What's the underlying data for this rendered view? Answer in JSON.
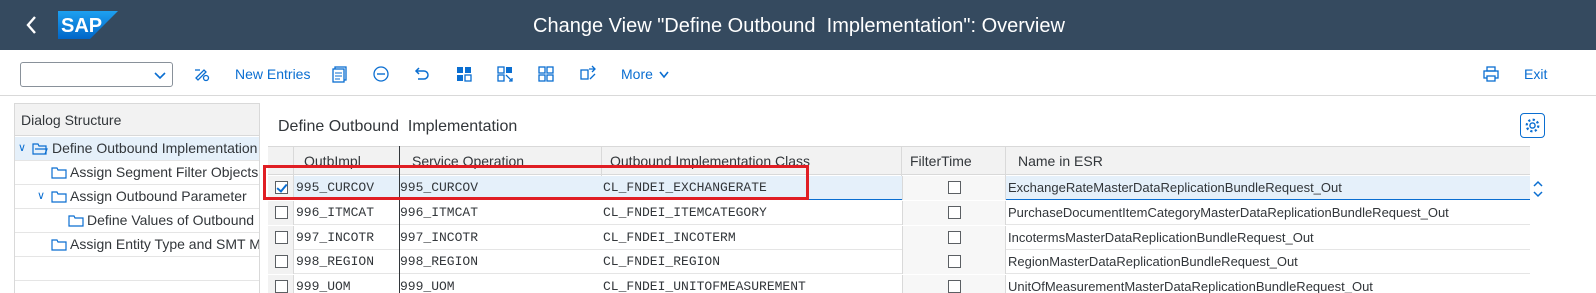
{
  "header": {
    "title": "Change View \"Define Outbound  Implementation\": Overview",
    "logo_text": "SAP"
  },
  "toolbar": {
    "dropdown_value": "",
    "new_entries": "New Entries",
    "more": "More",
    "exit": "Exit"
  },
  "dialog": {
    "heading": "Dialog Structure",
    "items": [
      {
        "label": "Define Outbound  Implementation",
        "selected": true
      },
      {
        "label": "Assign Segment Filter Objects"
      },
      {
        "label": "Assign Outbound Parameter"
      },
      {
        "label": "Define Values of Outbound P"
      },
      {
        "label": "Assign Entity Type and SMT Map"
      }
    ]
  },
  "main": {
    "title": "Define Outbound  Implementation",
    "columns": [
      "OutbImpl",
      "Service Operation",
      "Outbound Implementation Class",
      "FilterTime",
      "Name in ESR"
    ],
    "rows": [
      {
        "selected": true,
        "outb": "995_CURCOV",
        "service": "995_CURCOV",
        "cls": "CL_FNDEI_EXCHANGERATE",
        "filter": false,
        "esr": "ExchangeRateMasterDataReplicationBundleRequest_Out"
      },
      {
        "selected": false,
        "outb": "996_ITMCAT",
        "service": "996_ITMCAT",
        "cls": "CL_FNDEI_ITEMCATEGORY",
        "filter": false,
        "esr": "PurchaseDocumentItemCategoryMasterDataReplicationBundleRequest_Out"
      },
      {
        "selected": false,
        "outb": "997_INCOTR",
        "service": "997_INCOTR",
        "cls": "CL_FNDEI_INCOTERM",
        "filter": false,
        "esr": "IncotermsMasterDataReplicationBundleRequest_Out"
      },
      {
        "selected": false,
        "outb": "998_REGION",
        "service": "998_REGION",
        "cls": "CL_FNDEI_REGION",
        "filter": false,
        "esr": "RegionMasterDataReplicationBundleRequest_Out"
      },
      {
        "selected": false,
        "outb": "999_UOM",
        "service": "999_UOM",
        "cls": "CL_FNDEI_UNITOFMEASUREMENT",
        "filter": false,
        "esr": "UnitOfMeasurementMasterDataReplicationBundleRequest_Out"
      }
    ]
  },
  "colors": {
    "shell": "#354a5f",
    "accent": "#0a6ed1",
    "highlight": "#e01e24"
  }
}
